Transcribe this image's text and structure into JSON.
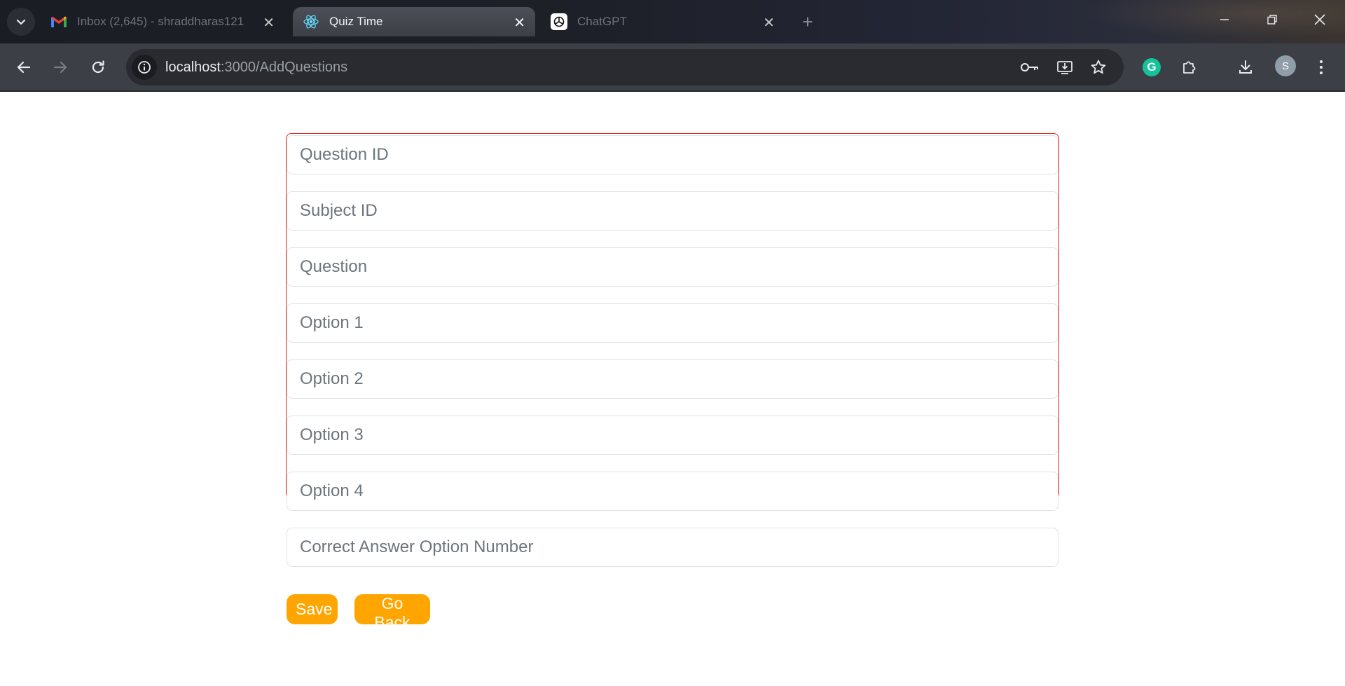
{
  "browser": {
    "tabs": [
      {
        "title": "Inbox (2,645) - shraddharas121",
        "icon": "gmail-icon",
        "active": false
      },
      {
        "title": "Quiz Time",
        "icon": "react-icon",
        "active": true
      },
      {
        "title": "ChatGPT",
        "icon": "chatgpt-icon",
        "active": false
      }
    ],
    "address": {
      "host": "localhost",
      "path": ":3000/AddQuestions"
    },
    "profile_initial": "S"
  },
  "form": {
    "fields": [
      {
        "placeholder": "Question ID",
        "value": ""
      },
      {
        "placeholder": "Subject ID",
        "value": ""
      },
      {
        "placeholder": "Question",
        "value": ""
      },
      {
        "placeholder": "Option 1",
        "value": ""
      },
      {
        "placeholder": "Option 2",
        "value": ""
      },
      {
        "placeholder": "Option 3",
        "value": ""
      },
      {
        "placeholder": "Option 4",
        "value": ""
      },
      {
        "placeholder": "Correct Answer Option Number",
        "value": ""
      }
    ],
    "save_label": "Save",
    "back_label": "Go Back"
  },
  "colors": {
    "accent": "#ffa500",
    "form_border": "#e8231f"
  }
}
